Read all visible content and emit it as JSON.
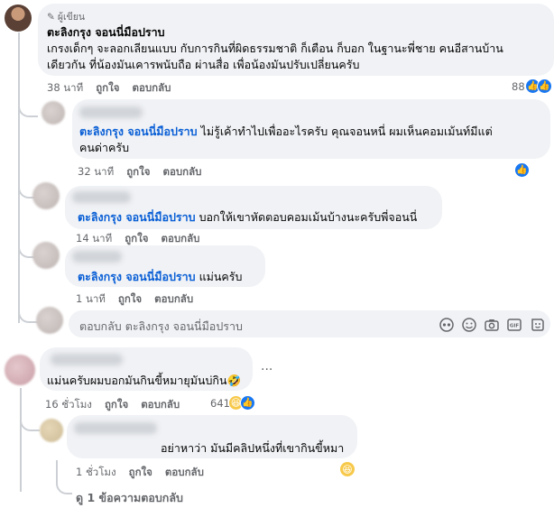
{
  "colors": {
    "link": "#0a5fd6",
    "bubble": "#f0f2f5",
    "meta": "#65676b",
    "like": "#1877f2"
  },
  "c1": {
    "author_badge": "ผู้เขียน",
    "name": "ตะลิงกรุง จอนนี่มือปราบ",
    "text_line1": "เกรงเด็กๆ จะลอกเลียนแบบ กับการกินที่ผิดธรรมชาติ ก็เตือน ก็บอก ในฐานะพี่ชาย คนอีสานบ้าน",
    "text_line2": "เดียวกัน ที่น้องมันเคารพนับถือ ผ่านสื่อ เพื่อน้องมันปรับเปลี่ยนครับ",
    "time": "38 นาที",
    "like": "ถูกใจ",
    "reply": "ตอบกลับ",
    "reactions": "88"
  },
  "c2": {
    "tag": "ตะลิงกรุง จอนนี่มือปราบ",
    "text_after_tag": " ไม่รู้เค้าทำไปเพื่ออะไรครับ คุณจอนหนี่ ผมเห็นคอมเม้นท์มีแต่",
    "text_line2": "คนด่าครับ",
    "time": "32 นาที",
    "like": "ถูกใจ",
    "reply": "ตอบกลับ"
  },
  "c3": {
    "tag": "ตะลิงกรุง จอนนี่มือปราบ",
    "text": " บอกให้เขาหัดตอบคอมเม้นบ้างนะครับพี่จอนนี่",
    "time": "14 นาที",
    "like": "ถูกใจ",
    "reply": "ตอบกลับ"
  },
  "c4": {
    "tag": "ตะลิงกรุง จอนนี่มือปราบ",
    "text": " แม่นครับ",
    "time": "1 นาที",
    "like": "ถูกใจ",
    "reply": "ตอบกลับ"
  },
  "reply_box": {
    "placeholder": "ตอบกลับ ตะลิงกรุง จอนนี่มือปราบ"
  },
  "c5": {
    "text": "แม่นครับผมบอกมันกินขี้หมายุมันบ่กิน🤣",
    "more": "···",
    "time": "16 ชั่วโมง",
    "like": "ถูกใจ",
    "reply": "ตอบกลับ",
    "reactions": "641"
  },
  "c6": {
    "text": "อย่าหาว่า มันมีคลิปหนึ่งที่เขากินขี้หมา",
    "time": "1 ชั่วโมง",
    "like": "ถูกใจ",
    "reply": "ตอบกลับ"
  },
  "view_replies": "ดู 1 ข้อความตอบกลับ"
}
